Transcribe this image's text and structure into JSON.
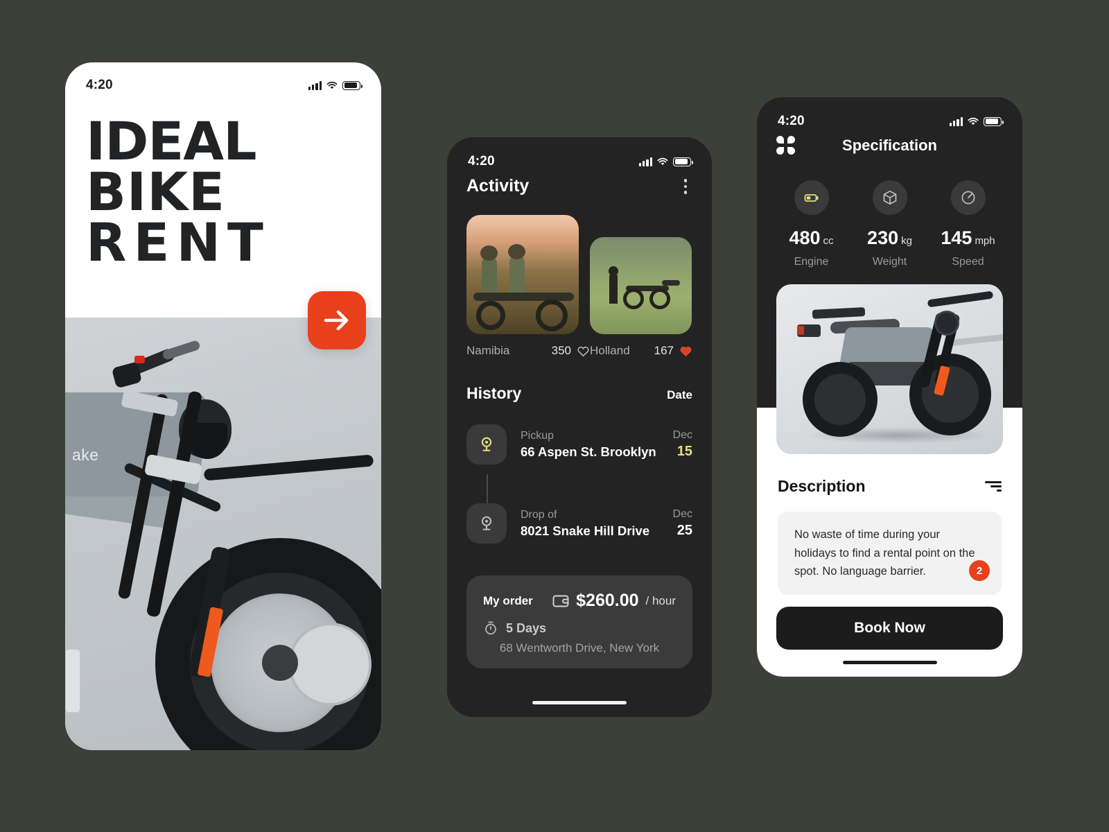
{
  "canvas": {
    "background_color": "#3d4038",
    "accent_color": "#e8401b",
    "yellow_accent": "#e4e07a"
  },
  "phone1": {
    "status": {
      "time": "4:20",
      "signal_icon": "cellular-bars-icon",
      "wifi_icon": "wifi-icon",
      "battery_icon": "battery-icon"
    },
    "logo": {
      "line1": "IDEAL",
      "line2": "BIKE",
      "line3": "RENT"
    },
    "cta": {
      "icon": "arrow-right-icon",
      "label": ""
    },
    "hero": {
      "bike_brand_text": "ake"
    }
  },
  "phone2": {
    "status": {
      "time": "4:20",
      "signal_icon": "cellular-bars-icon",
      "wifi_icon": "wifi-icon",
      "battery_icon": "battery-icon"
    },
    "header": {
      "title": "Activity",
      "menu_icon": "kebab-menu-icon"
    },
    "gallery": [
      {
        "name": "Namibia",
        "likes": "350",
        "liked": false,
        "heart_icon": "heart-outline-icon"
      },
      {
        "name": "Holland",
        "likes": "167",
        "liked": true,
        "heart_icon": "heart-filled-icon"
      }
    ],
    "history": {
      "title": "History",
      "date_column_label": "Date",
      "entries": [
        {
          "type": "Pickup",
          "address": "66 Aspen St. Brooklyn",
          "month": "Dec",
          "day": "15",
          "icon": "location-pin-icon",
          "highlight": true
        },
        {
          "type": "Drop of",
          "address": "8021 Snake Hill Drive",
          "month": "Dec",
          "day": "25",
          "icon": "location-pin-icon",
          "highlight": false
        }
      ]
    },
    "order": {
      "label": "My order",
      "wallet_icon": "wallet-icon",
      "price": "$260.00",
      "period": "/ hour",
      "duration_icon": "stopwatch-icon",
      "duration": "5 Days",
      "address": "68 Wentworth Drive, New York"
    },
    "home_indicator": true
  },
  "phone3": {
    "status": {
      "time": "4:20",
      "signal_icon": "cellular-bars-icon",
      "wifi_icon": "wifi-icon",
      "battery_icon": "battery-icon"
    },
    "header": {
      "grid_icon": "grid-apps-icon",
      "title": "Specification"
    },
    "specs": [
      {
        "value": "480",
        "unit": "cc",
        "label": "Engine",
        "icon": "battery-icon",
        "active": true
      },
      {
        "value": "230",
        "unit": "kg",
        "label": "Weight",
        "icon": "cube-3d-icon",
        "active": false
      },
      {
        "value": "145",
        "unit": "mph",
        "label": "Speed",
        "icon": "speedometer-icon",
        "active": false
      }
    ],
    "description": {
      "title": "Description",
      "filter_icon": "filter-lines-icon",
      "body": "No waste of time during your holidays to find a rental point on the spot. No language barrier.",
      "badge": "2"
    },
    "book_button": "Book Now",
    "home_indicator": true
  }
}
